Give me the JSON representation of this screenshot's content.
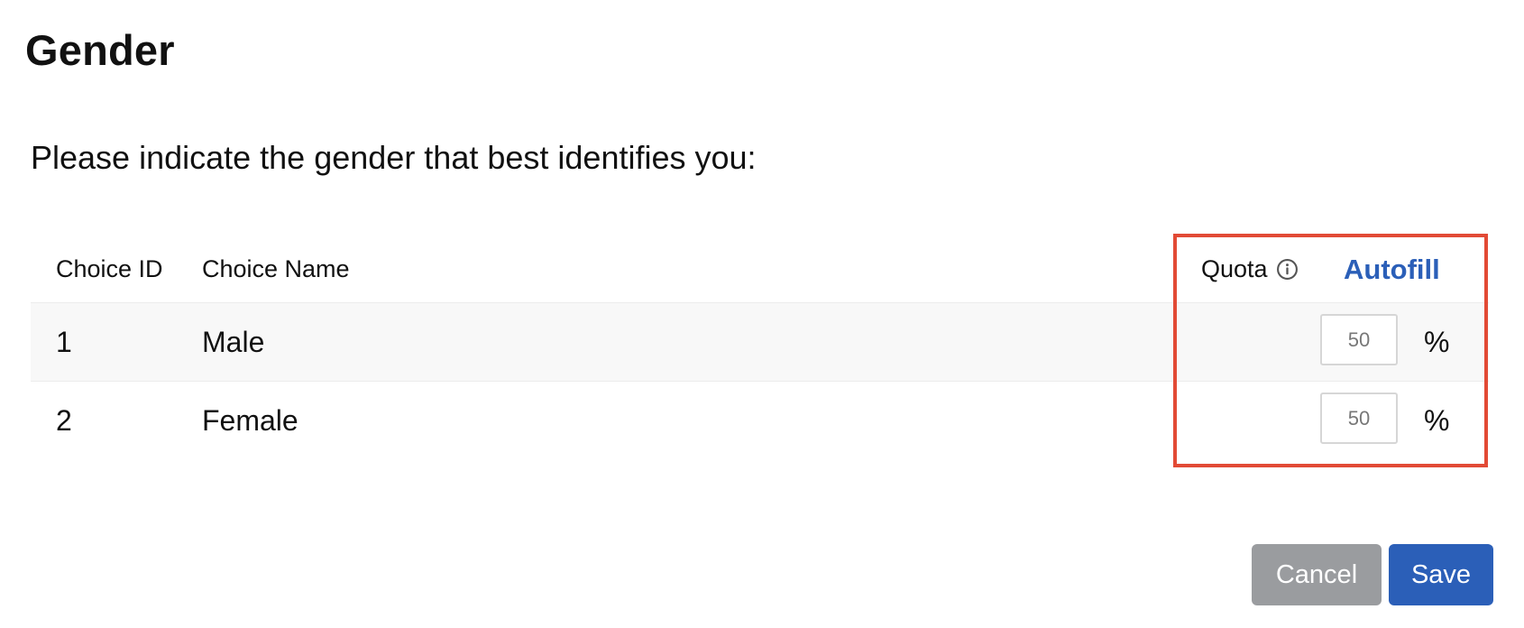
{
  "page": {
    "title": "Gender",
    "question": "Please indicate the gender that best identifies you:"
  },
  "table": {
    "headers": {
      "choice_id": "Choice ID",
      "choice_name": "Choice Name",
      "quota": "Quota",
      "autofill": "Autofill"
    },
    "rows": [
      {
        "id": "1",
        "name": "Male",
        "quota": "50",
        "unit": "%"
      },
      {
        "id": "2",
        "name": "Female",
        "quota": "50",
        "unit": "%"
      }
    ]
  },
  "icons": {
    "quota_info": "info-circle-icon"
  },
  "actions": {
    "cancel_label": "Cancel",
    "save_label": "Save"
  },
  "colors": {
    "primary": "#2b5fb8",
    "cancel": "#9a9c9f",
    "highlight": "#e24a35"
  }
}
